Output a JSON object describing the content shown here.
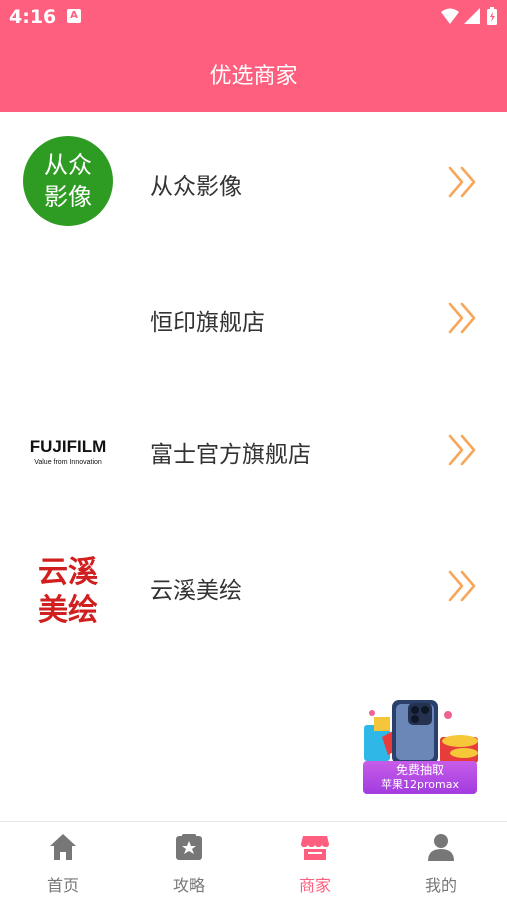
{
  "status_bar": {
    "time": "4:16",
    "notification_letter": "A"
  },
  "header": {
    "title": "优选商家"
  },
  "merchants": [
    {
      "name": "从众影像",
      "logo_text": [
        "从众",
        "影像"
      ],
      "logo_color": "#2e9b22"
    },
    {
      "name": "恒印旗舰店"
    },
    {
      "name": "富士官方旗舰店",
      "logo_text": [
        "FUJIFILM",
        "Value from Innovation"
      ]
    },
    {
      "name": "云溪美绘",
      "logo_text": [
        "云溪",
        "美绘"
      ],
      "logo_color": "#d11f1f"
    }
  ],
  "promo": {
    "line1": "免费抽取",
    "line2": "苹果12promax"
  },
  "tabs": [
    {
      "label": "首页",
      "icon": "home-icon"
    },
    {
      "label": "攻略",
      "icon": "guide-icon"
    },
    {
      "label": "商家",
      "icon": "store-icon",
      "active": true
    },
    {
      "label": "我的",
      "icon": "user-icon"
    }
  ],
  "colors": {
    "accent": "#ff5f7e",
    "chevron": "#f7a75c",
    "tab_inactive": "#777777"
  }
}
